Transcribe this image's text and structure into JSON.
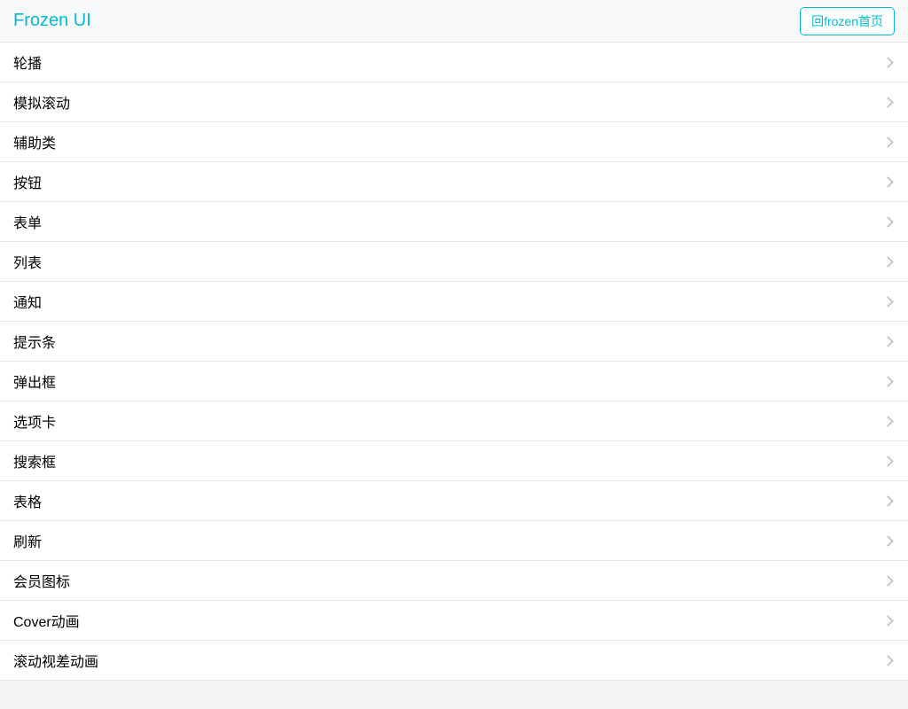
{
  "header": {
    "title": "Frozen UI",
    "back_button_label": "回frozen首页"
  },
  "list": {
    "items": [
      {
        "label": "轮播"
      },
      {
        "label": "模拟滚动"
      },
      {
        "label": "辅助类"
      },
      {
        "label": "按钮"
      },
      {
        "label": "表单"
      },
      {
        "label": "列表"
      },
      {
        "label": "通知"
      },
      {
        "label": "提示条"
      },
      {
        "label": "弹出框"
      },
      {
        "label": "选项卡"
      },
      {
        "label": "搜索框"
      },
      {
        "label": "表格"
      },
      {
        "label": "刷新"
      },
      {
        "label": "会员图标"
      },
      {
        "label": "Cover动画"
      },
      {
        "label": "滚动视差动画"
      }
    ]
  }
}
